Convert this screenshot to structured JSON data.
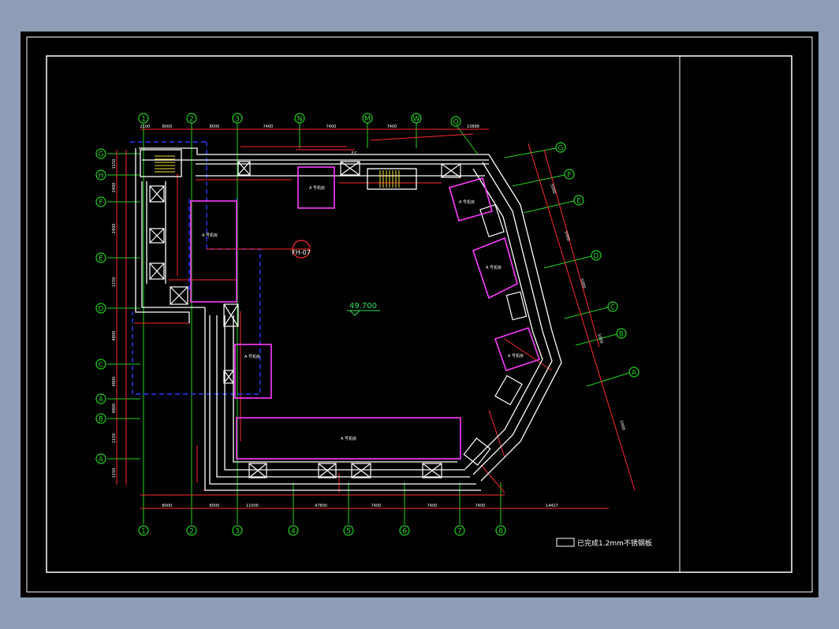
{
  "drawing": {
    "elevation_label": "49.700",
    "section_marker": "FH-07",
    "legend_text": "已完成1.2mm不锈钢板",
    "column_label": "F.C.",
    "room_label": "A 号机房",
    "colors": {
      "background": "#000000",
      "frame": "#ffffff",
      "wall": "#ffffff",
      "dimension": "#ff2a2a",
      "grid": "#21d421",
      "room": "#ff3cff",
      "hidden": "#2a3cff",
      "stair": "#f0e040",
      "elevation": "#30e060"
    }
  },
  "grid_bottom": [
    "1",
    "2",
    "3",
    "4",
    "5",
    "6",
    "7",
    "8"
  ],
  "grid_top": [
    "1",
    "2",
    "3",
    "N",
    "M",
    "W",
    "Q"
  ],
  "grid_left": [
    "G",
    "H",
    "F",
    "E",
    "D",
    "C",
    "A",
    "B",
    "A"
  ],
  "grid_right": [
    "G",
    "F",
    "E",
    "D",
    "C",
    "B",
    "A"
  ],
  "dims": {
    "bottom": [
      "8000",
      "8000",
      "11000",
      "47800",
      "7400",
      "7400",
      "7400",
      "14427"
    ],
    "top": [
      "2100",
      "8000",
      "8000",
      "7400",
      "7400",
      "7400",
      "10888"
    ],
    "left": [
      "1150",
      "2400",
      "2400",
      "1150",
      "4800",
      "4800",
      "4800",
      "1150",
      "1150"
    ],
    "right": [
      "5000",
      "5000",
      "5000",
      "5000",
      "5000"
    ]
  }
}
